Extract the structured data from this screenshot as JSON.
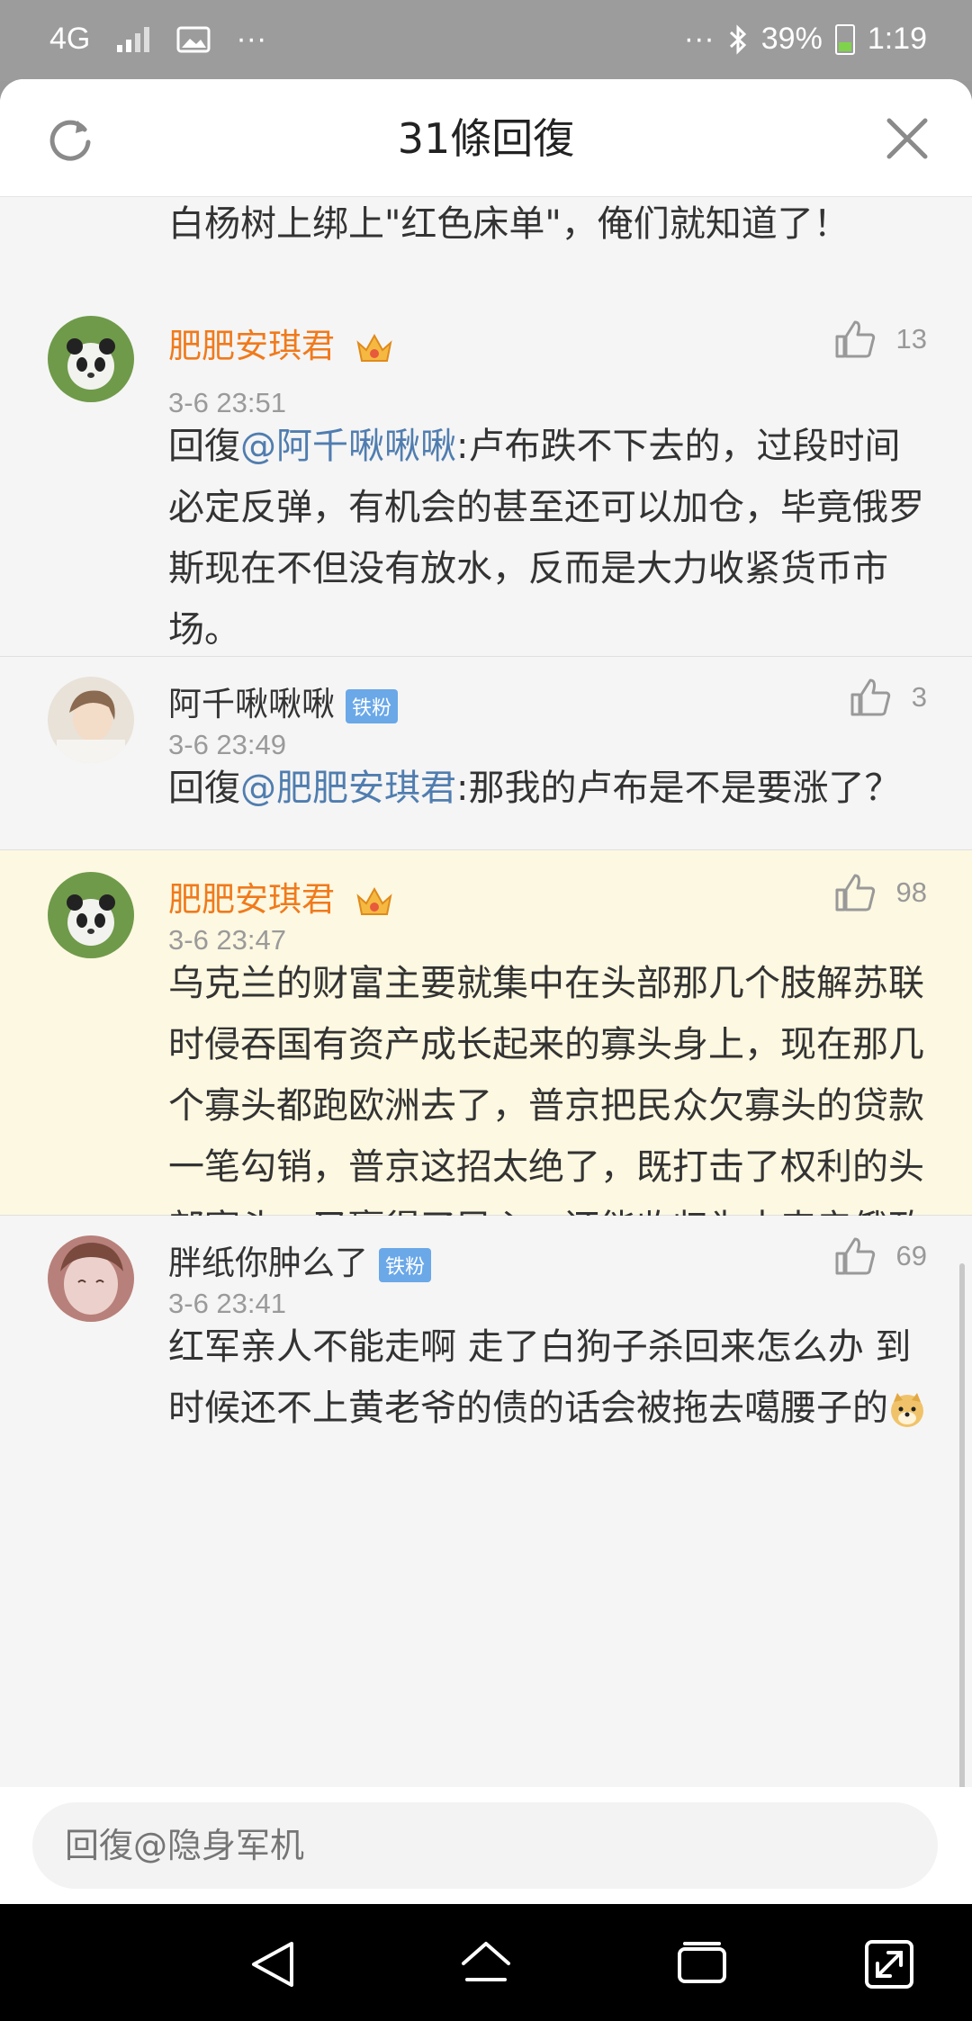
{
  "status_bar": {
    "network": "4G",
    "dots_left": "···",
    "dots_right": "···",
    "battery": "39%",
    "time": "1:19"
  },
  "header": {
    "title": "31條回復"
  },
  "partial_comment": {
    "text": "白杨树上绑上\"红色床单\"，俺们就知道了！"
  },
  "comments": [
    {
      "name": "肥肥安琪君",
      "time": "3-6 23:51",
      "likes": "13",
      "reply_prefix": "回復",
      "mention": "@阿千啾啾啾",
      "text": ":卢布跌不下去的，过段时间必定反弹，有机会的甚至还可以加仓，毕竟俄罗斯现在不但没有放水，反而是大力收紧货币市场。"
    },
    {
      "name": "阿千啾啾啾",
      "badge": "铁粉",
      "time": "3-6 23:49",
      "likes": "3",
      "reply_prefix": "回復",
      "mention": "@肥肥安琪君",
      "text": ":那我的卢布是不是要涨了？"
    },
    {
      "name": "肥肥安琪君",
      "time": "3-6 23:47",
      "likes": "98",
      "text": "乌克兰的财富主要就集中在头部那几个肢解苏联时侵吞国有资产成长起来的寡头身上，现在那几个寡头都跑欧洲去了，普京把民众欠寡头的贷款一笔勾销，普京这招太绝了，既打击了权利的头部寡头，又赢得了民心，还能收归为未来亲俄政府的国有资产"
    },
    {
      "name": "胖纸你肿么了",
      "badge": "铁粉",
      "time": "3-6 23:41",
      "likes": "69",
      "text": "红军亲人不能走啊 走了白狗子杀回来怎么办 到时候还不上黄老爷的债的话会被拖去噶腰子的"
    }
  ],
  "reply_bar": {
    "placeholder": "回復@隐身军机"
  }
}
